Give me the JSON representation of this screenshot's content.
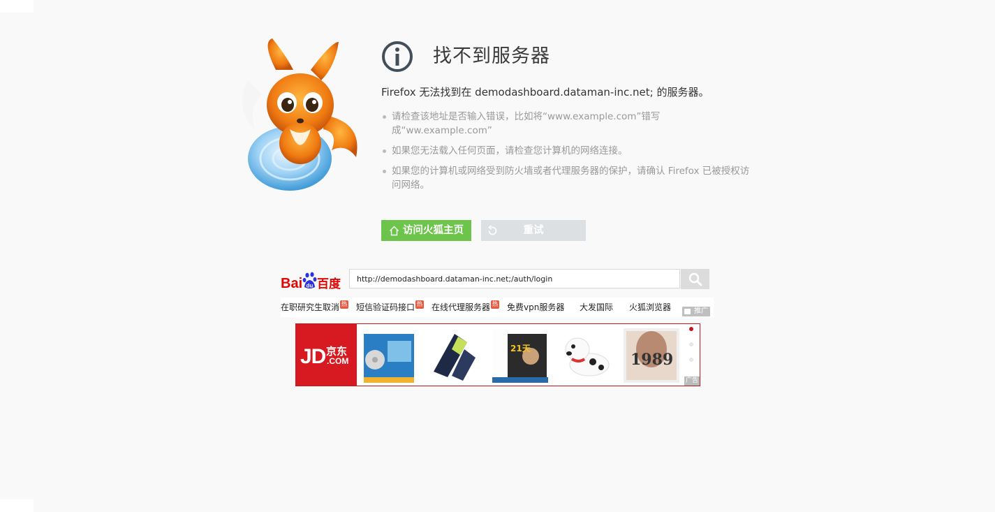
{
  "error": {
    "title": "找不到服务器",
    "subtitle": "Firefox 无法找到在 demodashboard.dataman-inc.net; 的服务器。",
    "tips": [
      "请检查该地址是否输入错误，比如将“www.example.com”错写成“ww.example.com”",
      "如果您无法载入任何页面，请检查您计算机的网络连接。",
      "如果您的计算机或网络受到防火墙或者代理服务器的保护，请确认 Firefox 已被授权访问网络。"
    ]
  },
  "buttons": {
    "home_label": "访问火狐主页",
    "retry_label": "重试"
  },
  "baidu": {
    "logo_text": "Bai百度",
    "search_value": "http://demodashboard.dataman-inc.net;/auth/login",
    "hot_links": [
      {
        "label": "在职研究生取消",
        "hot": "热"
      },
      {
        "label": "短信验证码接口",
        "hot": "热"
      },
      {
        "label": "在线代理服务器",
        "hot": "热"
      },
      {
        "label": "免费vpn服务器",
        "hot": ""
      },
      {
        "label": "大发国际",
        "hot": ""
      },
      {
        "label": "火狐浏览器",
        "hot": ""
      }
    ],
    "promo_label": "推广"
  },
  "jd_ad": {
    "logo_jd": "JD",
    "logo_cn": "京东",
    "logo_com": ".COM",
    "products": [
      "book-cd-icon",
      "playboy-socks-icon",
      "book-21days-icon",
      "robot-dog-toy-icon",
      "taylor-swift-1989-album-icon"
    ],
    "ad_label": "广告"
  },
  "colors": {
    "home_button": "#6cc44a",
    "retry_button": "#dde0e3",
    "jd_red": "#d71a21",
    "baidu_red": "#e10601",
    "baidu_blue": "#2932e1"
  }
}
